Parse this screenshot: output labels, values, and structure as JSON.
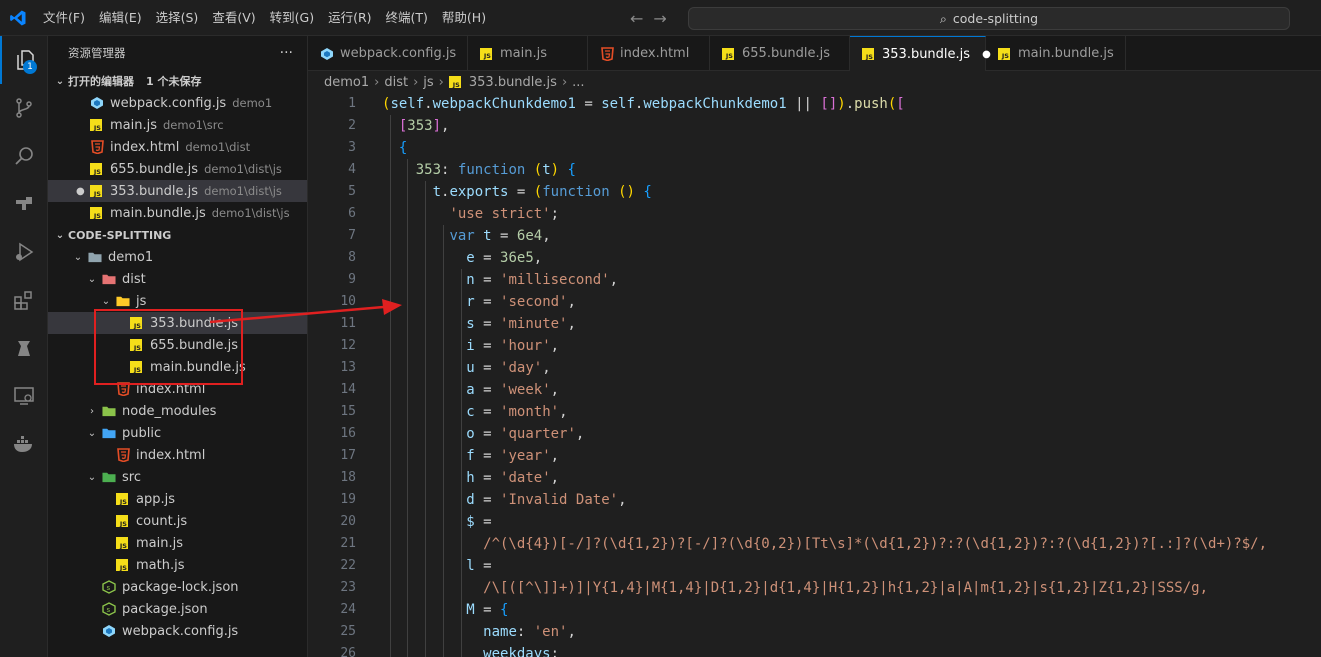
{
  "titlebar": {
    "menus": [
      "文件(F)",
      "编辑(E)",
      "选择(S)",
      "查看(V)",
      "转到(G)",
      "运行(R)",
      "终端(T)",
      "帮助(H)"
    ],
    "search_text": "code-splitting"
  },
  "activity_bar": {
    "explorer_badge": "1",
    "icons": [
      "files-icon",
      "source-control-icon",
      "search-icon",
      "remote-icon",
      "run-debug-icon",
      "extensions-icon",
      "test-icon",
      "remote-explorer-icon",
      "docker-icon"
    ]
  },
  "sidebar": {
    "title": "资源管理器",
    "more": "···",
    "open_editors": {
      "label": "打开的编辑器",
      "unsaved": "1 个未保存",
      "items": [
        {
          "name": "webpack.config.js",
          "desc": "demo1",
          "icon": "webpack"
        },
        {
          "name": "main.js",
          "desc": "demo1\\src",
          "icon": "js"
        },
        {
          "name": "index.html",
          "desc": "demo1\\dist",
          "icon": "html"
        },
        {
          "name": "655.bundle.js",
          "desc": "demo1\\dist\\js",
          "icon": "js"
        },
        {
          "name": "353.bundle.js",
          "desc": "demo1\\dist\\js",
          "icon": "js",
          "selected": true
        },
        {
          "name": "main.bundle.js",
          "desc": "demo1\\dist\\js",
          "icon": "js"
        }
      ]
    },
    "project": {
      "label": "CODE-SPLITTING",
      "tree": [
        {
          "name": "demo1",
          "depth": 0,
          "type": "folder",
          "open": true
        },
        {
          "name": "dist",
          "depth": 1,
          "type": "folder-dist",
          "open": true
        },
        {
          "name": "js",
          "depth": 2,
          "type": "folder-js",
          "open": true
        },
        {
          "name": "353.bundle.js",
          "depth": 3,
          "type": "js",
          "selected": true
        },
        {
          "name": "655.bundle.js",
          "depth": 3,
          "type": "js"
        },
        {
          "name": "main.bundle.js",
          "depth": 3,
          "type": "js"
        },
        {
          "name": "index.html",
          "depth": 2,
          "type": "html"
        },
        {
          "name": "node_modules",
          "depth": 1,
          "type": "folder-node",
          "open": false
        },
        {
          "name": "public",
          "depth": 1,
          "type": "folder-public",
          "open": true
        },
        {
          "name": "index.html",
          "depth": 2,
          "type": "html"
        },
        {
          "name": "src",
          "depth": 1,
          "type": "folder-src",
          "open": true
        },
        {
          "name": "app.js",
          "depth": 2,
          "type": "js"
        },
        {
          "name": "count.js",
          "depth": 2,
          "type": "js"
        },
        {
          "name": "main.js",
          "depth": 2,
          "type": "js"
        },
        {
          "name": "math.js",
          "depth": 2,
          "type": "js"
        },
        {
          "name": "package-lock.json",
          "depth": 1,
          "type": "json"
        },
        {
          "name": "package.json",
          "depth": 1,
          "type": "json"
        },
        {
          "name": "webpack.config.js",
          "depth": 1,
          "type": "webpack"
        }
      ]
    }
  },
  "tabs": [
    {
      "label": "webpack.config.js",
      "icon": "webpack"
    },
    {
      "label": "main.js",
      "icon": "js"
    },
    {
      "label": "index.html",
      "icon": "html"
    },
    {
      "label": "655.bundle.js",
      "icon": "js"
    },
    {
      "label": "353.bundle.js",
      "icon": "js",
      "active": true,
      "dirty": true
    },
    {
      "label": "main.bundle.js",
      "icon": "js"
    }
  ],
  "breadcrumb": [
    "demo1",
    "dist",
    "js",
    "353.bundle.js",
    "..."
  ],
  "editor": {
    "line_numbers": [
      "1",
      "2",
      "3",
      "4",
      "5",
      "6",
      "7",
      "8",
      "9",
      "10",
      "11",
      "12",
      "13",
      "14",
      "15",
      "16",
      "17",
      "18",
      "19",
      "20",
      "21",
      "22",
      "23",
      "24",
      "25",
      "26"
    ],
    "lines": [
      "(self.webpackChunkdemo1 = self.webpackChunkdemo1 || []).push([",
      "  [353],",
      "  {",
      "    353: function (t) {",
      "      t.exports = (function () {",
      "        'use strict';",
      "        var t = 6e4,",
      "          e = 36e5,",
      "          n = 'millisecond',",
      "          r = 'second',",
      "          s = 'minute',",
      "          i = 'hour',",
      "          u = 'day',",
      "          a = 'week',",
      "          c = 'month',",
      "          o = 'quarter',",
      "          f = 'year',",
      "          h = 'date',",
      "          d = 'Invalid Date',",
      "          $ =",
      "            /^(\\d{4})[-/]?(\\d{1,2})?[-/]?(\\d{0,2})[Tt\\s]*(\\d{1,2})?:?(\\d{1,2})?:?(\\d{1,2})?[.:]?(\\d+)?$/,",
      "          l =",
      "            /\\[([^\\]]+)]|Y{1,4}|M{1,4}|D{1,2}|d{1,4}|H{1,2}|h{1,2}|a|A|m{1,2}|s{1,2}|Z{1,2}|SSS/g,",
      "          M = {",
      "            name: 'en',",
      "            weekdays:"
    ]
  },
  "colors": {
    "accent": "#0078d4",
    "annotation": "#e02020",
    "js_icon": "#f5de19",
    "html_icon": "#e44d26"
  }
}
